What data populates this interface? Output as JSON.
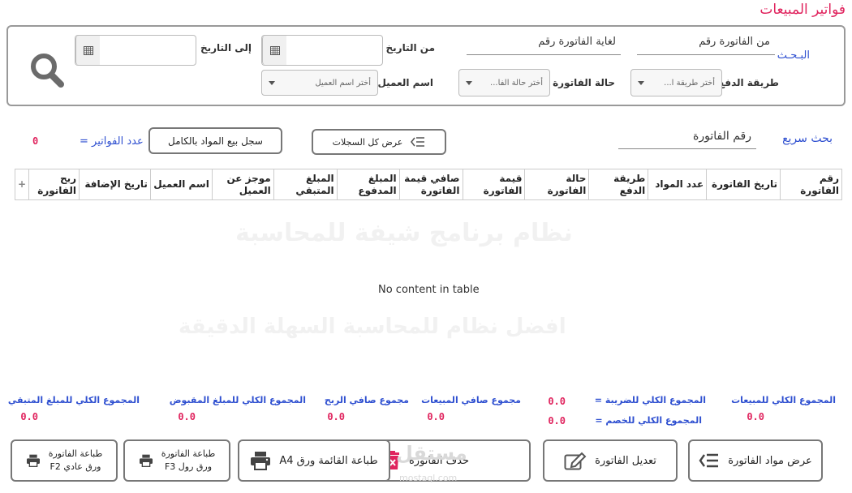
{
  "page_title": "فواتير المبيعات",
  "search": {
    "label": "البـحـث",
    "from_invoice": "من الفاتورة رقم",
    "to_invoice": "لغاية الفاتورة رقم",
    "from_date_label": "من التاريخ",
    "to_date_label": "إلى التاريخ",
    "payment_method_label": "طريقة الدفع",
    "payment_method_value": "أختر طريقة ا...",
    "invoice_status_label": "حالة الفاتورة",
    "invoice_status_value": "أختر حالة الفا...",
    "customer_label": "اسم العميل",
    "customer_value": "أختر اسم العميل"
  },
  "quick": {
    "label": "بحث سريع",
    "field": "رقم الفاتورة",
    "show_all": "عرض كل السجلات",
    "full_log": "سجل بيع المواد بالكامل",
    "count_label": "عدد الفواتير =",
    "count_value": "0"
  },
  "table": {
    "headers": [
      "رقم الفاتورة",
      "تاريخ الفاتورة",
      "عدد المواد",
      "طريقة الدفع",
      "حالة الفاتورة",
      "قيمة الفاتورة",
      "صافي قيمة الفاتورة",
      "المبلغ المدفوع",
      "المبلغ المتبقي",
      "موجز عن العميل",
      "اسم العميل",
      "تاريخ الإضافة",
      "ربح الفاتورة"
    ],
    "plus": "+",
    "empty": "No content in table"
  },
  "watermark": {
    "line1": "نظام برنامج شيفة للمحاسبة",
    "line2": "افضل نظام للمحاسبة السهلة الدقيقة"
  },
  "totals": {
    "sales_label": "المجموع الكلي للمبيعات",
    "sales_value": "0.0",
    "tax_label": "المجموع الكلي للضريبة =",
    "tax_value": "0.0",
    "discount_label": "المجموع الكلي للخصم =",
    "discount_value": "0.0",
    "net_sales_label": "مجموع صافي المبيعات",
    "net_sales_value": "0.0",
    "net_profit_label": "مجموع صافي الربح",
    "net_profit_value": "0.0",
    "received_label": "المجموع الكلي للمبلغ المقبوض",
    "received_value": "0.0",
    "remaining_label": "المجموع الكلي للمبلغ المتبقي",
    "remaining_value": "0.0"
  },
  "buttons": {
    "view_items": "عرض مواد الفاتورة",
    "edit": "تعديل الفاتورة",
    "delete": "حذف الفاتورة",
    "print_a4": "طباعة القائمة ورق A4",
    "print_roll_1": "طباعة الفاتورة",
    "print_roll_2": "ورق رول F3",
    "print_plain_1": "طباعة الفاتورة",
    "print_plain_2": "ورق عادي F2"
  },
  "brand": {
    "name": "مستقل",
    "url": "mostaql.com"
  },
  "colors": {
    "accent": "#e0245e",
    "link": "#2e4fd0"
  }
}
